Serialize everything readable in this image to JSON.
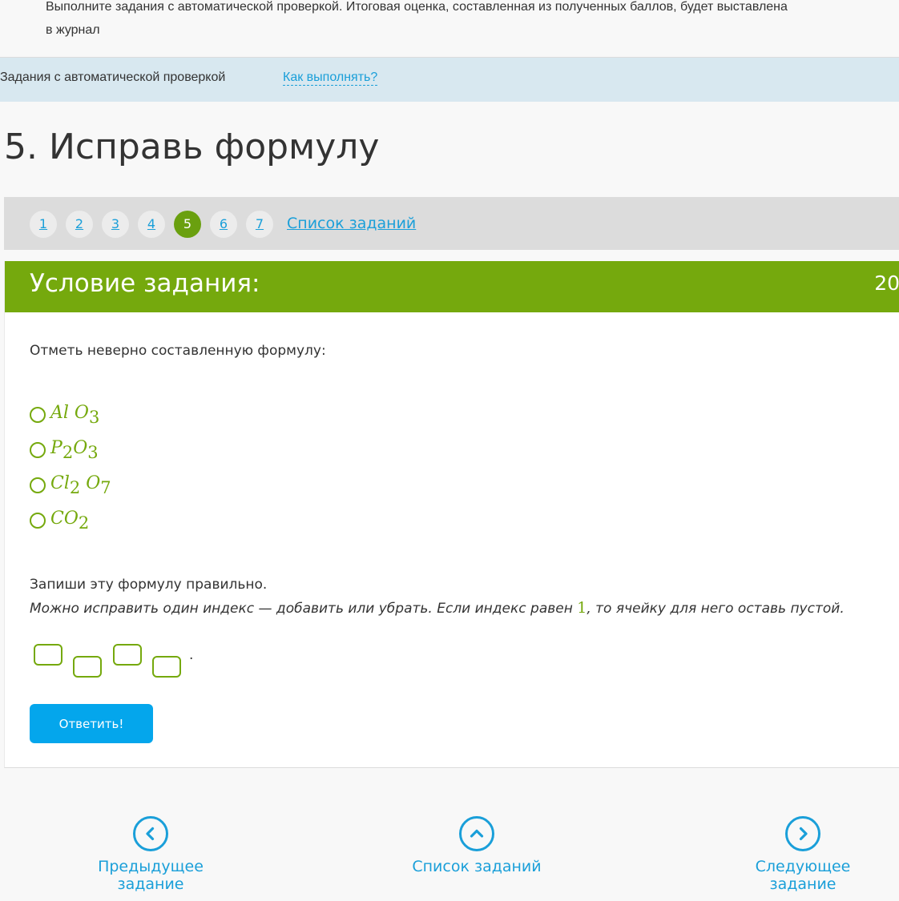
{
  "intro": {
    "line1": "Выполните задания с автоматической проверкой. Итоговая оценка, составленная из полученных баллов, будет выставлена",
    "line2": "в журнал"
  },
  "info_bar": {
    "label": "Задания с автоматической проверкой",
    "help_link": "Как выполнять?"
  },
  "page_title": "5. Исправь формулу",
  "pager": {
    "numbers": [
      "1",
      "2",
      "3",
      "4",
      "5",
      "6",
      "7"
    ],
    "active": "5",
    "list_link": "Список заданий"
  },
  "task": {
    "header": "Условие задания:",
    "points": "20",
    "question1": "Отметь неверно составленную формулу:",
    "options": [
      {
        "parts": [
          "Al O",
          "3"
        ]
      },
      {
        "parts": [
          "P",
          "2",
          "O",
          "3"
        ]
      },
      {
        "parts": [
          "Cl",
          "2",
          " O",
          "7"
        ]
      },
      {
        "parts": [
          "CO",
          "2"
        ]
      }
    ],
    "question2": "Запиши эту формулу правильно.",
    "note_before": "Можно исправить один индекс — добавить или убрать. Если индекс равен ",
    "note_one": "1",
    "note_after": ", то ячейку для него оставь пустой.",
    "cells_dot": ".",
    "answer_button": "Ответить!"
  },
  "bottom_nav": {
    "prev": "Предыдущее задание",
    "list": "Список заданий",
    "next": "Следующее задание"
  },
  "colors": {
    "accent_green": "#75a90d",
    "link_blue": "#1a9fd9",
    "button_blue": "#04a6ec"
  }
}
